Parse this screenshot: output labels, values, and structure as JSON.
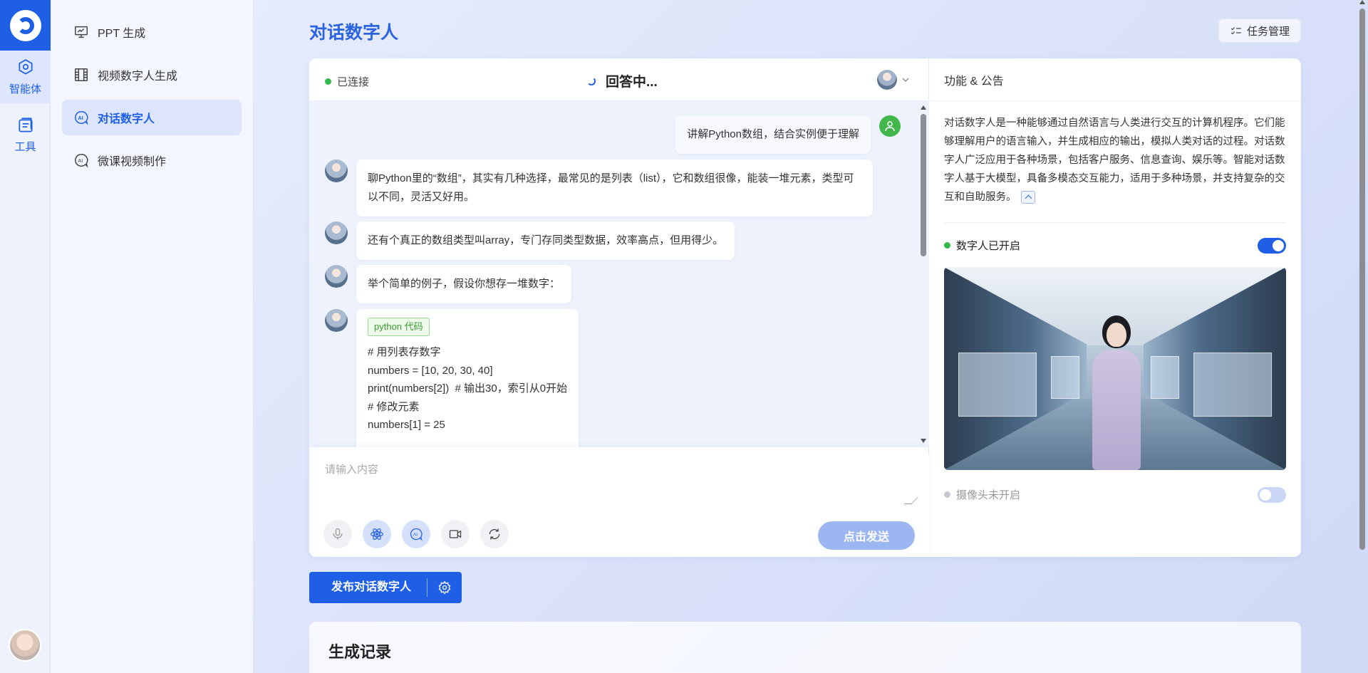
{
  "rail": {
    "items": [
      {
        "label": "智能体",
        "icon": "agent-icon",
        "active": true
      },
      {
        "label": "工具",
        "icon": "tools-icon",
        "active": false
      }
    ]
  },
  "subnav": {
    "items": [
      {
        "label": "PPT 生成",
        "icon": "presentation-icon"
      },
      {
        "label": "视频数字人生成",
        "icon": "film-icon"
      },
      {
        "label": "对话数字人",
        "icon": "ai-chat-icon",
        "active": true
      },
      {
        "label": "微课视频制作",
        "icon": "ai-chat-icon"
      }
    ]
  },
  "header": {
    "title": "对话数字人",
    "task_button": "任务管理"
  },
  "chat": {
    "status": "已连接",
    "answering": "回答中...",
    "messages": [
      {
        "role": "user",
        "text": "讲解Python数组，结合实例便于理解"
      },
      {
        "role": "bot",
        "text": "聊Python里的“数组”，其实有几种选择，最常见的是列表（list），它和数组很像，能装一堆元素，类型可以不同，灵活又好用。"
      },
      {
        "role": "bot",
        "text": "还有个真正的数组类型叫array，专门存同类型数据，效率高点，但用得少。"
      },
      {
        "role": "bot",
        "text": "举个简单的例子，假设你想存一堆数字："
      },
      {
        "role": "bot",
        "code_tag": "python 代码",
        "code": [
          "# 用列表存数字",
          "numbers = [10, 20, 30, 40]",
          "print(numbers[2])  # 输出30，索引从0开始",
          "",
          "# 修改元素",
          "numbers[1] = 25"
        ]
      }
    ],
    "input_placeholder": "请输入内容",
    "send_label": "点击发送",
    "tools": [
      "microphone-icon",
      "atom-icon",
      "ai-icon",
      "video-camera-icon",
      "refresh-icon"
    ]
  },
  "side": {
    "title": "功能 & 公告",
    "description": "对话数字人是一种能够通过自然语言与人类进行交互的计算机程序。它们能够理解用户的语言输入，并生成相应的输出，模拟人类对话的过程。对话数字人广泛应用于各种场景，包括客户服务、信息查询、娱乐等。智能对话数字人基于大模型，具备多模态交互能力，适用于多种场景，并支持复杂的交互和自助服务。",
    "digital_human_label": "数字人已开启",
    "digital_human_on": true,
    "camera_label": "摄像头未开启",
    "camera_on": false
  },
  "publish": {
    "label": "发布对话数字人"
  },
  "records": {
    "title": "生成记录"
  },
  "colors": {
    "accent": "#1e5fe6",
    "title": "#2b64e0",
    "connected": "#34b84a"
  }
}
